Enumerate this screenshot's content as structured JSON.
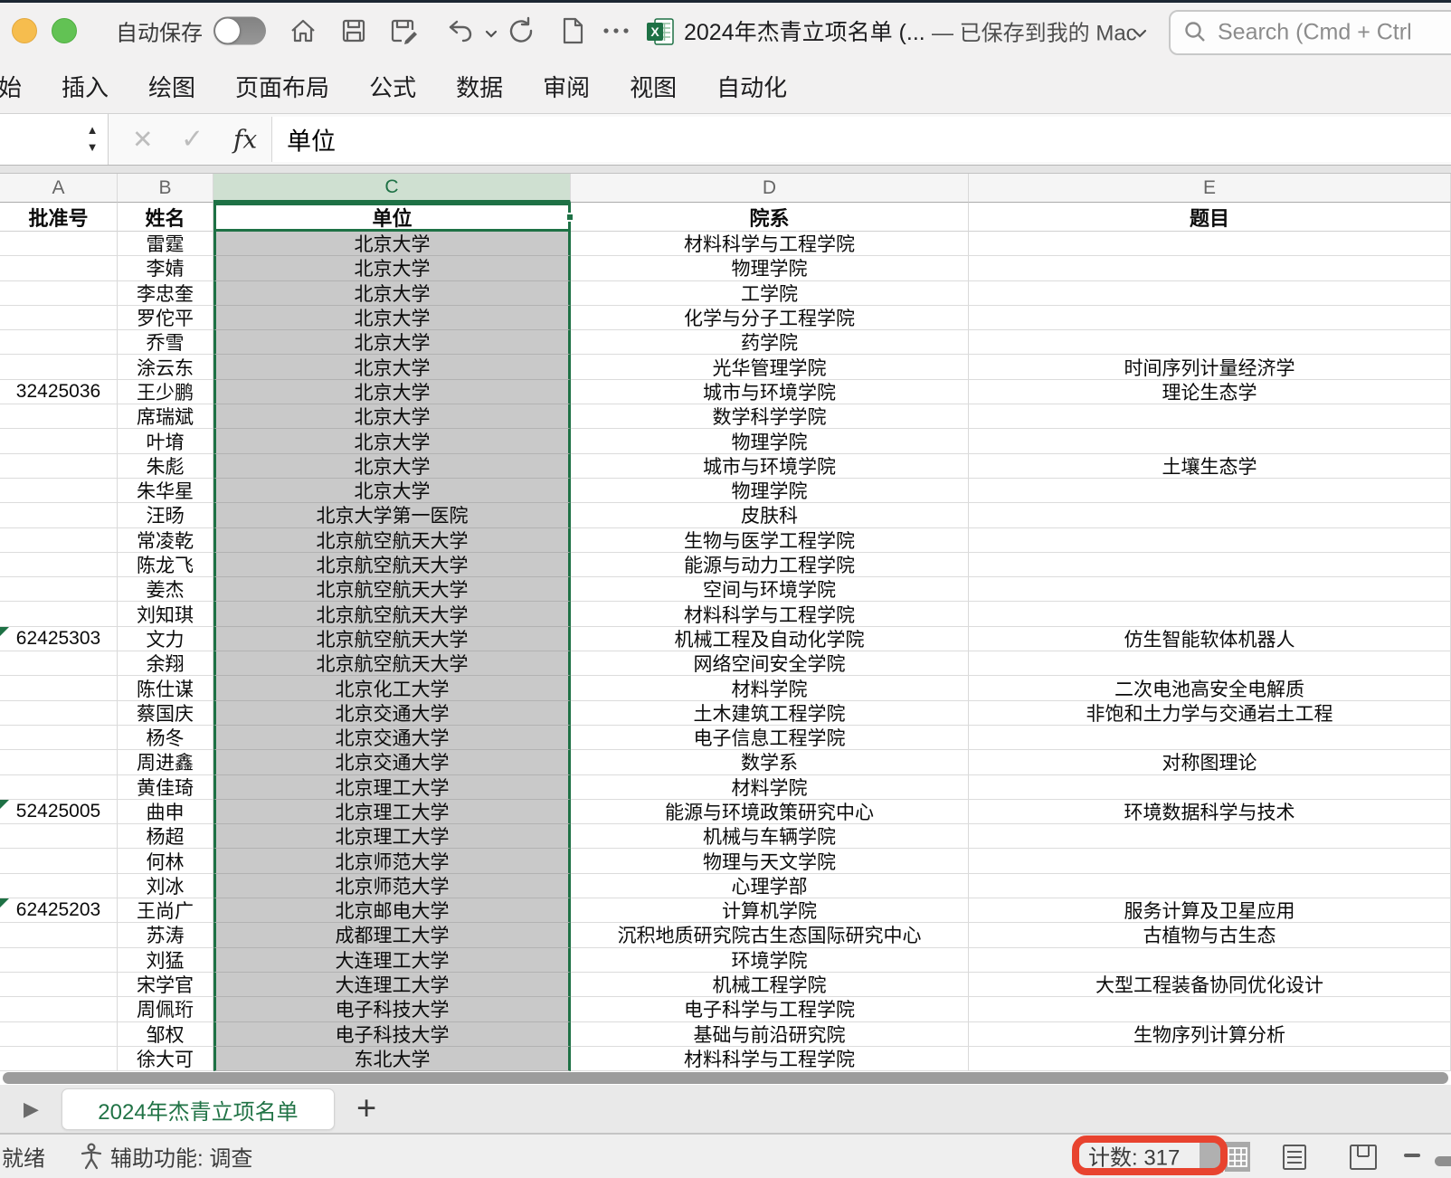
{
  "titlebar": {
    "autosave_label": "自动保存",
    "autosave_state": "off",
    "doc_title": "2024年杰青立项名单 (...",
    "saved_status": "— 已保存到我的 Mac",
    "search_placeholder": "Search (Cmd + Ctrl"
  },
  "ribbon": {
    "tabs": [
      "始",
      "插入",
      "绘图",
      "页面布局",
      "公式",
      "数据",
      "审阅",
      "视图",
      "自动化"
    ]
  },
  "formula_bar": {
    "fx_label": "fx",
    "value": "单位"
  },
  "grid": {
    "column_letters": [
      "A",
      "B",
      "C",
      "D",
      "E"
    ],
    "selected_column": "C",
    "headers": [
      "批准号",
      "姓名",
      "单位",
      "院系",
      "题目"
    ],
    "active_cell_value": "单位",
    "rows": [
      {
        "approval": "",
        "name": "雷霆",
        "unit": "北京大学",
        "dept": "材料科学与工程学院",
        "title": "",
        "flag": false
      },
      {
        "approval": "",
        "name": "李婧",
        "unit": "北京大学",
        "dept": "物理学院",
        "title": "",
        "flag": false
      },
      {
        "approval": "",
        "name": "李忠奎",
        "unit": "北京大学",
        "dept": "工学院",
        "title": "",
        "flag": false
      },
      {
        "approval": "",
        "name": "罗佗平",
        "unit": "北京大学",
        "dept": "化学与分子工程学院",
        "title": "",
        "flag": false
      },
      {
        "approval": "",
        "name": "乔雪",
        "unit": "北京大学",
        "dept": "药学院",
        "title": "",
        "flag": false
      },
      {
        "approval": "",
        "name": "涂云东",
        "unit": "北京大学",
        "dept": "光华管理学院",
        "title": "时间序列计量经济学",
        "flag": false
      },
      {
        "approval": "32425036",
        "name": "王少鹏",
        "unit": "北京大学",
        "dept": "城市与环境学院",
        "title": "理论生态学",
        "flag": false
      },
      {
        "approval": "",
        "name": "席瑞斌",
        "unit": "北京大学",
        "dept": "数学科学学院",
        "title": "",
        "flag": false
      },
      {
        "approval": "",
        "name": "叶堉",
        "unit": "北京大学",
        "dept": "物理学院",
        "title": "",
        "flag": false
      },
      {
        "approval": "",
        "name": "朱彪",
        "unit": "北京大学",
        "dept": "城市与环境学院",
        "title": "土壤生态学",
        "flag": false
      },
      {
        "approval": "",
        "name": "朱华星",
        "unit": "北京大学",
        "dept": "物理学院",
        "title": "",
        "flag": false
      },
      {
        "approval": "",
        "name": "汪旸",
        "unit": "北京大学第一医院",
        "dept": "皮肤科",
        "title": "",
        "flag": false
      },
      {
        "approval": "",
        "name": "常凌乾",
        "unit": "北京航空航天大学",
        "dept": "生物与医学工程学院",
        "title": "",
        "flag": false
      },
      {
        "approval": "",
        "name": "陈龙飞",
        "unit": "北京航空航天大学",
        "dept": "能源与动力工程学院",
        "title": "",
        "flag": false
      },
      {
        "approval": "",
        "name": "姜杰",
        "unit": "北京航空航天大学",
        "dept": "空间与环境学院",
        "title": "",
        "flag": false
      },
      {
        "approval": "",
        "name": "刘知琪",
        "unit": "北京航空航天大学",
        "dept": "材料科学与工程学院",
        "title": "",
        "flag": false
      },
      {
        "approval": "62425303",
        "name": "文力",
        "unit": "北京航空航天大学",
        "dept": "机械工程及自动化学院",
        "title": "仿生智能软体机器人",
        "flag": true
      },
      {
        "approval": "",
        "name": "余翔",
        "unit": "北京航空航天大学",
        "dept": "网络空间安全学院",
        "title": "",
        "flag": false
      },
      {
        "approval": "",
        "name": "陈仕谋",
        "unit": "北京化工大学",
        "dept": "材料学院",
        "title": "二次电池高安全电解质",
        "flag": false
      },
      {
        "approval": "",
        "name": "蔡国庆",
        "unit": "北京交通大学",
        "dept": "土木建筑工程学院",
        "title": "非饱和土力学与交通岩土工程",
        "flag": false
      },
      {
        "approval": "",
        "name": "杨冬",
        "unit": "北京交通大学",
        "dept": "电子信息工程学院",
        "title": "",
        "flag": false
      },
      {
        "approval": "",
        "name": "周进鑫",
        "unit": "北京交通大学",
        "dept": "数学系",
        "title": "对称图理论",
        "flag": false
      },
      {
        "approval": "",
        "name": "黄佳琦",
        "unit": "北京理工大学",
        "dept": "材料学院",
        "title": "",
        "flag": false
      },
      {
        "approval": "52425005",
        "name": "曲申",
        "unit": "北京理工大学",
        "dept": "能源与环境政策研究中心",
        "title": "环境数据科学与技术",
        "flag": true
      },
      {
        "approval": "",
        "name": "杨超",
        "unit": "北京理工大学",
        "dept": "机械与车辆学院",
        "title": "",
        "flag": false
      },
      {
        "approval": "",
        "name": "何林",
        "unit": "北京师范大学",
        "dept": "物理与天文学院",
        "title": "",
        "flag": false
      },
      {
        "approval": "",
        "name": "刘冰",
        "unit": "北京师范大学",
        "dept": "心理学部",
        "title": "",
        "flag": false
      },
      {
        "approval": "62425203",
        "name": "王尚广",
        "unit": "北京邮电大学",
        "dept": "计算机学院",
        "title": "服务计算及卫星应用",
        "flag": true
      },
      {
        "approval": "",
        "name": "苏涛",
        "unit": "成都理工大学",
        "dept": "沉积地质研究院古生态国际研究中心",
        "title": "古植物与古生态",
        "flag": false
      },
      {
        "approval": "",
        "name": "刘猛",
        "unit": "大连理工大学",
        "dept": "环境学院",
        "title": "",
        "flag": false
      },
      {
        "approval": "",
        "name": "宋学官",
        "unit": "大连理工大学",
        "dept": "机械工程学院",
        "title": "大型工程装备协同优化设计",
        "flag": false
      },
      {
        "approval": "",
        "name": "周佩珩",
        "unit": "电子科技大学",
        "dept": "电子科学与工程学院",
        "title": "",
        "flag": false
      },
      {
        "approval": "",
        "name": "邹权",
        "unit": "电子科技大学",
        "dept": "基础与前沿研究院",
        "title": "生物序列计算分析",
        "flag": false
      },
      {
        "approval": "",
        "name": "徐大可",
        "unit": "东北大学",
        "dept": "材料科学与工程学院",
        "title": "",
        "flag": false
      }
    ]
  },
  "sheet_tabs": {
    "active": "2024年杰青立项名单",
    "add_label": "+"
  },
  "statusbar": {
    "ready": "就绪",
    "accessibility": "辅助功能: 调查",
    "count_label": "计数: 317"
  },
  "colors": {
    "accent_green": "#217346",
    "selection_green": "#1e7145",
    "selected_fill": "#c9c9c9",
    "column_header_selected": "#cfe0d1",
    "annotation_red": "#e8432f",
    "traffic_yellow": "#f6bd4e",
    "traffic_green": "#62c254"
  }
}
